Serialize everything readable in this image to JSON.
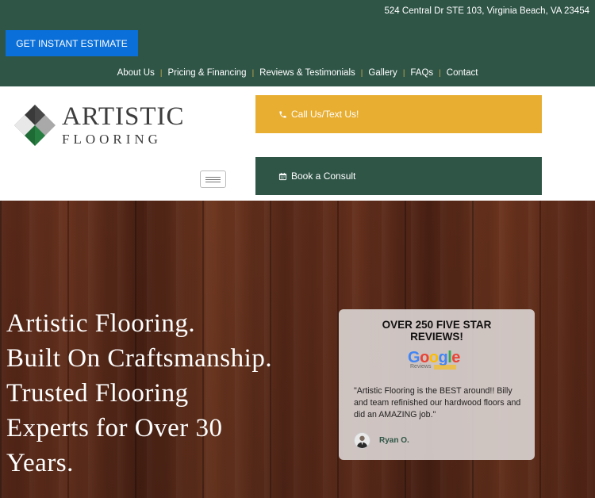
{
  "header": {
    "address": "524 Central Dr STE 103, Virginia Beach, VA 23454",
    "estimate_button": "GET INSTANT ESTIMATE"
  },
  "nav": {
    "items": [
      {
        "label": "About Us"
      },
      {
        "label": "Pricing & Financing"
      },
      {
        "label": "Reviews & Testimonials"
      },
      {
        "label": "Gallery"
      },
      {
        "label": "FAQs"
      },
      {
        "label": "Contact"
      }
    ]
  },
  "logo": {
    "line1": "ARTISTIC",
    "line2": "FLOORING"
  },
  "cta": {
    "call_label": "Call Us/Text Us!",
    "consult_label": "Book a Consult"
  },
  "hero": {
    "headline_lines": [
      "Artistic Flooring.",
      "Built On Craftsmanship.",
      "Trusted Flooring",
      "Experts for Over 30",
      "Years."
    ]
  },
  "review_card": {
    "title_line1": "OVER 250 FIVE STAR",
    "title_line2": "REVIEWS!",
    "google_word": [
      "G",
      "o",
      "o",
      "g",
      "l",
      "e"
    ],
    "google_reviews_label": "Reviews",
    "quote": "\"Artistic Flooring is the BEST around!! Billy and team refinished our hardwood floors and did an AMAZING job.\"",
    "reviewer_name": "Ryan O."
  },
  "colors": {
    "brand_green": "#2f5547",
    "gold": "#e8ae32",
    "blue": "#0a6fd8",
    "nav_separator": "#c9a94a"
  }
}
